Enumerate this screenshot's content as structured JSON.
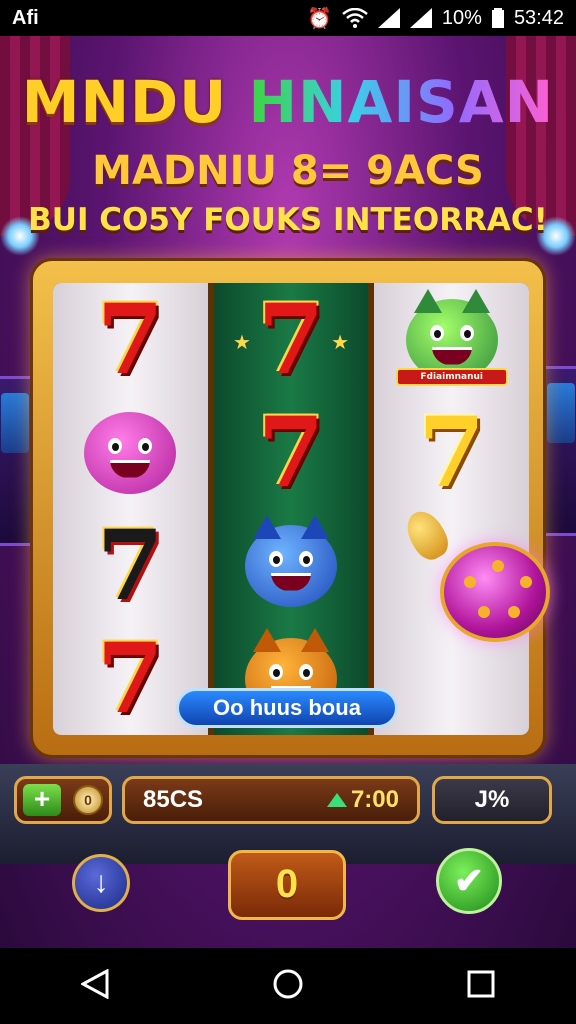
{
  "status_bar": {
    "left_text": "Afi",
    "battery": "10%",
    "time": "53:42",
    "icons": [
      "alarm-icon",
      "wifi-icon",
      "signal-icon",
      "signal-icon",
      "battery-icon"
    ]
  },
  "titles": {
    "line1_part1": "MNDU",
    "line1_part2": "HNAISAN",
    "line2": "MADNIU 8= 9ACS",
    "line3": "BUI CO5Y FOUKS INTEORRAC!"
  },
  "reels": [
    [
      "seven",
      "pink-creature",
      "seven-dark",
      "seven"
    ],
    [
      "seven",
      "seven",
      "blue-cat",
      "tiger"
    ],
    [
      "green-cat-badge",
      "gold-seven",
      "lever",
      "orb"
    ]
  ],
  "badge_text": "Fdiaimnanui",
  "pill_label": "Oo huus boua",
  "controls": {
    "plus_label": "+",
    "coin_label": "0",
    "bet_label": "85CS",
    "credits": "7:00",
    "percent": "J%",
    "spin_value": "0"
  },
  "colors": {
    "accent_gold": "#ffcf28",
    "spin_green": "#2e8a1a",
    "reel_green": "#1a7a45"
  }
}
